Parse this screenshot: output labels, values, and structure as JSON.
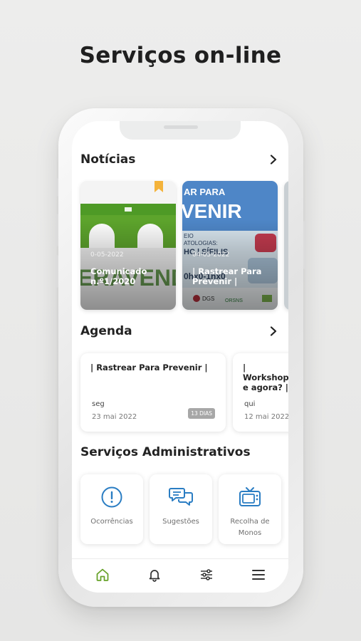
{
  "headline": "Serviços on-line",
  "colors": {
    "accent": "#2a7dc3",
    "active_nav": "#68a22a",
    "bookmark": "#f4b33b",
    "badge": "#a7a7a7"
  },
  "noticias": {
    "title": "Notícias",
    "more_icon": "chevron-right-icon",
    "items": [
      {
        "date": "0-05-2022",
        "title": "Comunicado n.º1/2020",
        "bookmarked": true
      },
      {
        "date": "04-05-2022",
        "title": "| Rastrear Para Prevenir |",
        "bookmarked": false
      }
    ]
  },
  "agenda": {
    "title": "Agenda",
    "more_icon": "chevron-right-icon",
    "items": [
      {
        "title": "| Rastrear Para Prevenir |",
        "weekday": "seg",
        "date": "23 mai 2022",
        "badge": "13 DIAS"
      },
      {
        "title": "| Workshop e agora? |",
        "weekday": "qui",
        "date": "12 mai 2022",
        "badge": ""
      }
    ]
  },
  "servicos": {
    "title": "Serviços Administrativos",
    "items": [
      {
        "label": "Ocorrências",
        "icon": "alert-circle-icon"
      },
      {
        "label": "Sugestões",
        "icon": "chat-bubbles-icon"
      },
      {
        "label": "Recolha de Monos",
        "icon": "tv-icon"
      }
    ]
  },
  "nav": [
    {
      "name": "home",
      "icon": "home-icon",
      "active": true
    },
    {
      "name": "notifications",
      "icon": "bell-icon",
      "active": false
    },
    {
      "name": "settings",
      "icon": "sliders-icon",
      "active": false
    },
    {
      "name": "menu",
      "icon": "menu-icon",
      "active": false
    }
  ]
}
